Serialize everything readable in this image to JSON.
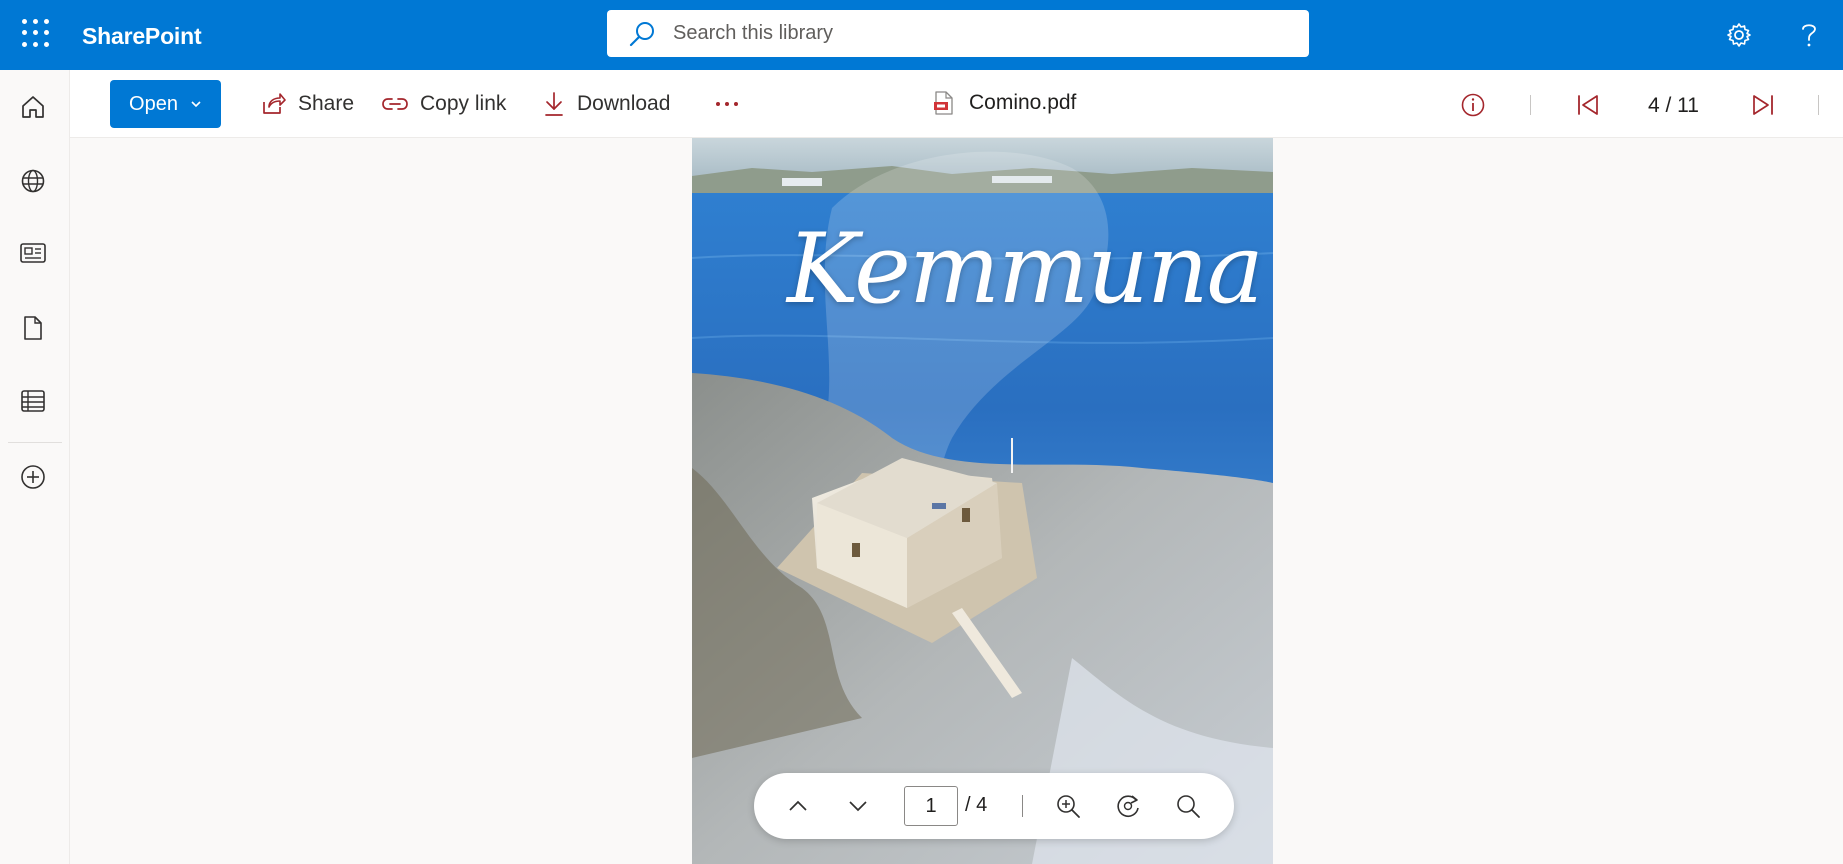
{
  "app": {
    "title": "SharePoint"
  },
  "search": {
    "placeholder": "Search this library"
  },
  "commands": {
    "open_label": "Open",
    "share_label": "Share",
    "copy_link_label": "Copy link",
    "download_label": "Download"
  },
  "file": {
    "name": "Comino.pdf"
  },
  "navigation": {
    "page_counter": "4 / 11"
  },
  "document": {
    "cover_title": "Kemmuna"
  },
  "floating_toolbar": {
    "current_page": "1",
    "page_total": "/ 4"
  },
  "icons": [
    "app-launcher-icon",
    "settings-icon",
    "help-icon",
    "home-icon",
    "globe-icon",
    "news-icon",
    "file-icon",
    "list-icon",
    "add-icon",
    "search-icon",
    "share-icon",
    "link-icon",
    "download-icon",
    "more-icon",
    "pdf-icon",
    "info-icon",
    "first-page-icon",
    "last-page-icon",
    "chevron-up-icon",
    "chevron-down-icon",
    "zoom-in-icon",
    "rotate-icon",
    "find-icon"
  ],
  "colors": {
    "brand": "#0078d4",
    "accent_icon": "#a4262c"
  }
}
